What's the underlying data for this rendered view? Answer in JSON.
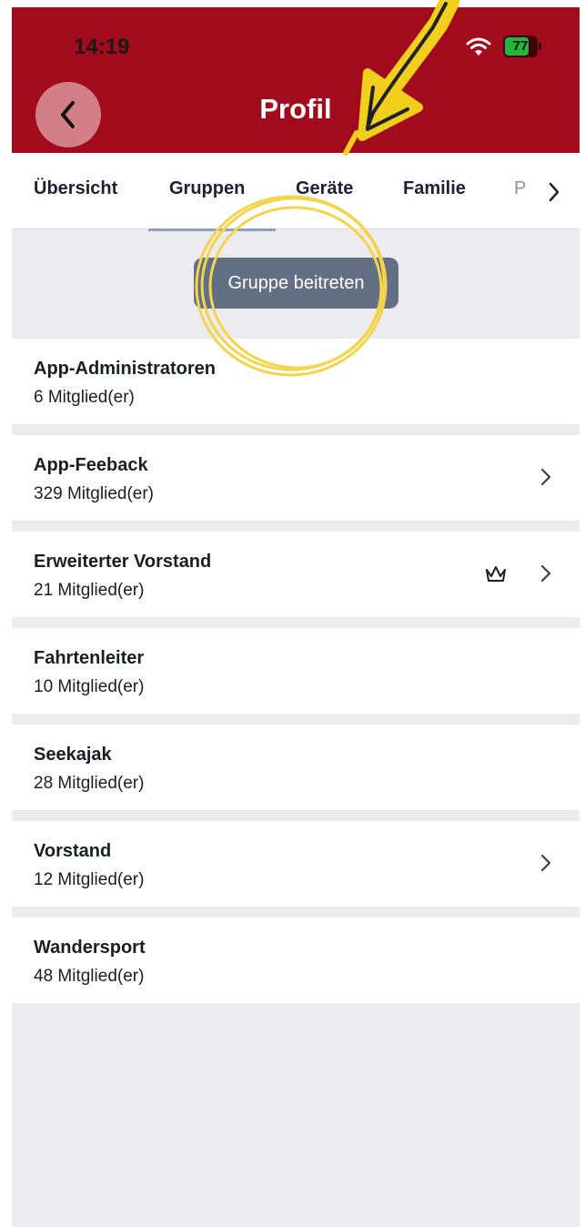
{
  "status_bar": {
    "time": "14:19",
    "battery_level": "77",
    "battery_fraction": 0.77,
    "wifi_icon": "wifi-icon"
  },
  "header": {
    "title": "Profil",
    "back_icon": "chevron-left-icon",
    "color": "#a10b1b"
  },
  "tabs": {
    "items": [
      {
        "label": "Übersicht",
        "active": false
      },
      {
        "label": "Gruppen",
        "active": true
      },
      {
        "label": "Geräte",
        "active": false
      },
      {
        "label": "Familie",
        "active": false
      },
      {
        "label": "P",
        "active": false
      }
    ],
    "more_icon": "chevron-right-icon"
  },
  "join_button": {
    "label": "Gruppe beitreten",
    "color": "#637083"
  },
  "groups": [
    {
      "name": "App-Administratoren",
      "members": "6 Mitglied(er)",
      "chevron": false,
      "crown": false
    },
    {
      "name": "App-Feeback",
      "members": "329 Mitglied(er)",
      "chevron": true,
      "crown": false
    },
    {
      "name": "Erweiterter Vorstand",
      "members": "21 Mitglied(er)",
      "chevron": true,
      "crown": true
    },
    {
      "name": "Fahrtenleiter",
      "members": "10 Mitglied(er)",
      "chevron": false,
      "crown": false
    },
    {
      "name": "Seekajak",
      "members": "28 Mitglied(er)",
      "chevron": false,
      "crown": false
    },
    {
      "name": "Vorstand",
      "members": "12 Mitglied(er)",
      "chevron": true,
      "crown": false
    },
    {
      "name": "Wandersport",
      "members": "48 Mitglied(er)",
      "chevron": false,
      "crown": false
    }
  ],
  "annotation": {
    "arrow_icon": "hand-drawn-arrow-icon",
    "circle_icon": "hand-drawn-circle-icon",
    "arrow_color": "#f2cf1d",
    "circle_color": "#f4d54a"
  }
}
